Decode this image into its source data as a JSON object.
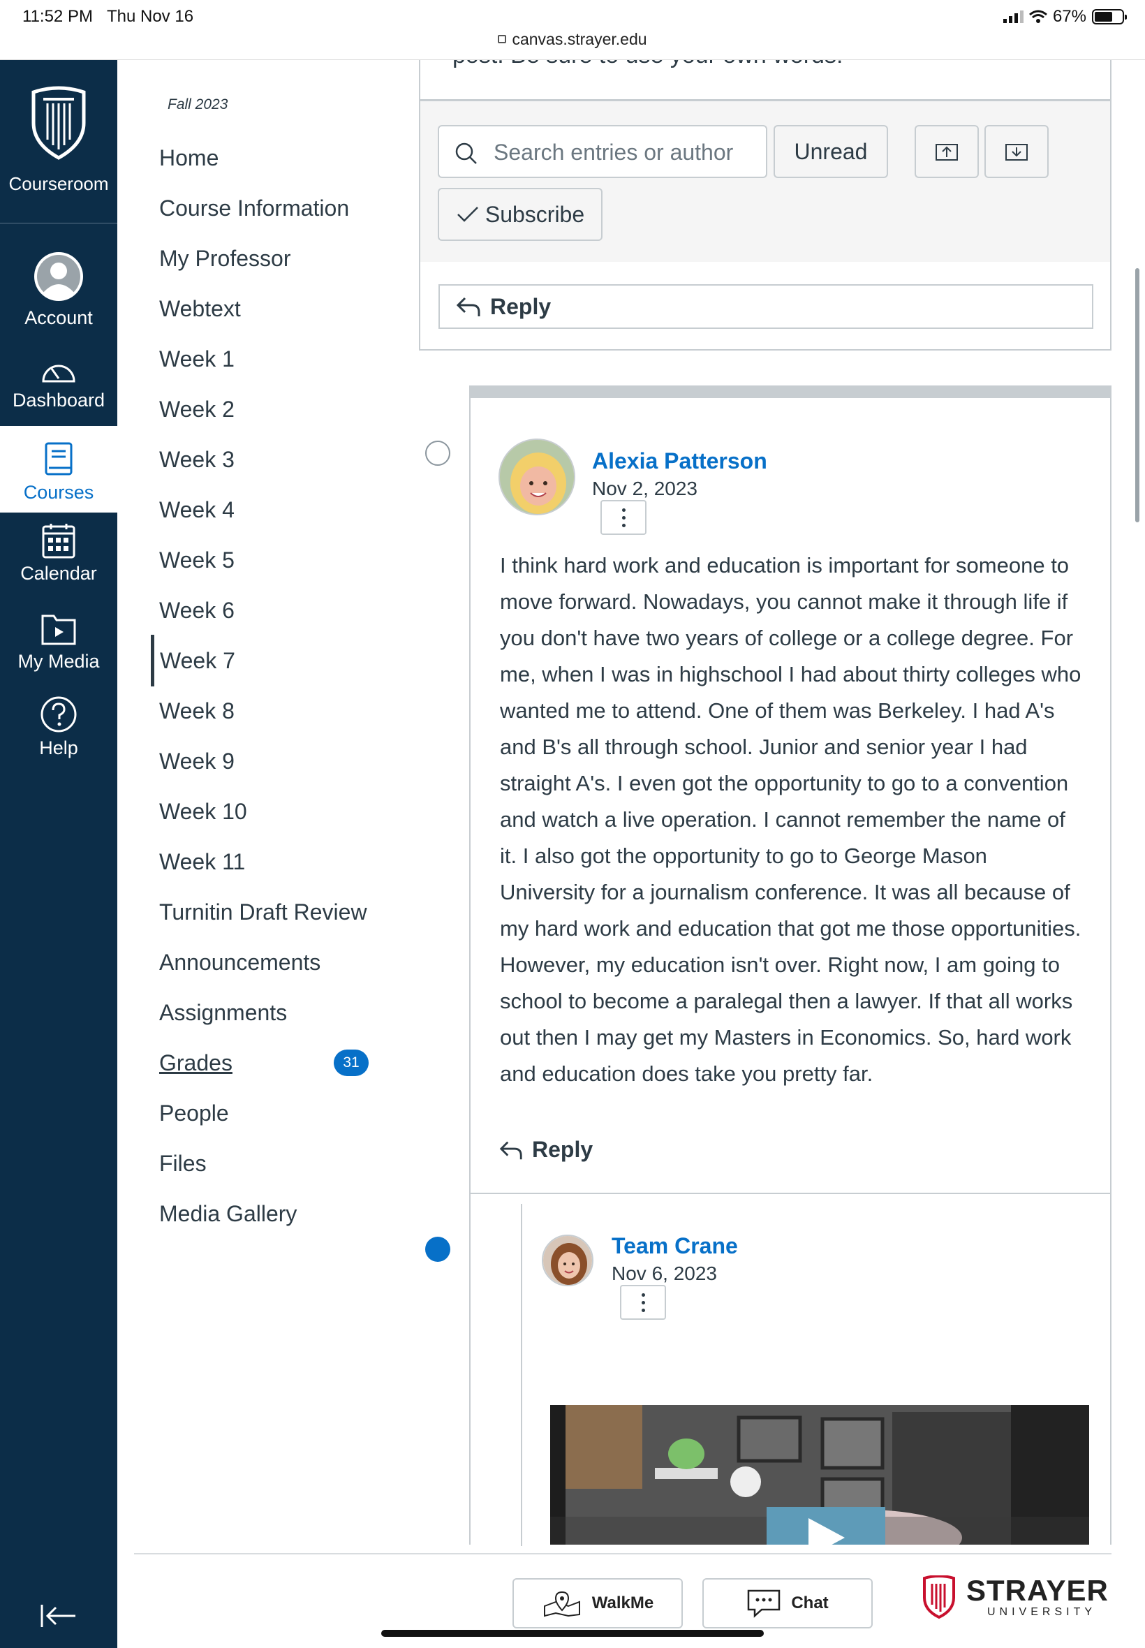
{
  "statusbar": {
    "time": "11:52 PM",
    "date": "Thu Nov 16",
    "url": "canvas.strayer.edu",
    "battery": "67%",
    "battery_level": 0.67
  },
  "globalnav": {
    "brand_label": "Courseroom",
    "items": [
      {
        "label": "Account",
        "icon": "account-avatar-icon"
      },
      {
        "label": "Dashboard",
        "icon": "dashboard-gauge-icon"
      },
      {
        "label": "Courses",
        "icon": "courses-book-icon"
      },
      {
        "label": "Calendar",
        "icon": "calendar-icon"
      },
      {
        "label": "My Media",
        "icon": "media-folder-icon"
      },
      {
        "label": "Help",
        "icon": "help-question-icon"
      }
    ]
  },
  "coursenav": {
    "term": "Fall 2023",
    "items": [
      "Home",
      "Course Information",
      "My Professor",
      "Webtext",
      "Week 1",
      "Week 2",
      "Week 3",
      "Week 4",
      "Week 5",
      "Week 6",
      "Week 7",
      "Week 8",
      "Week 9",
      "Week 10",
      "Week 11",
      "Turnitin Draft Review",
      "Announcements",
      "Assignments",
      "Grades",
      "People",
      "Files",
      "Media Gallery"
    ],
    "active": "Week 7",
    "grades_badge": "31"
  },
  "discussion": {
    "prompt_tail": "post. Be sure to use your own words!",
    "search_placeholder": "Search entries or author",
    "unread_label": "Unread",
    "subscribe_label": "Subscribe",
    "reply_label": "Reply"
  },
  "entries": [
    {
      "author": "Alexia Patterson",
      "date": "Nov 2, 2023",
      "body": "I think hard work and education is important for someone to move forward. Nowadays, you cannot make it through life if you don't have two years of college or a college degree. For me, when I was in highschool I had about thirty colleges who wanted me to attend. One of them was Berkeley. I had A's and B's all through school. Junior and senior year I had straight A's. I even got the opportunity to go to a convention and watch a live operation. I cannot remember the name of it. I also got the opportunity to go to George Mason University for a journalism conference. It was all because of my hard work and education that got me those opportunities. However, my education isn't over. Right now, I am going to school to become a paralegal then a lawyer. If that all works out then I may get my Masters in Economics. So, hard work and education does take you pretty far.",
      "reply_label": "Reply",
      "read": true
    },
    {
      "author": "Team Crane",
      "date": "Nov 6, 2023",
      "read": false
    }
  ],
  "bottombar": {
    "walkme_label": "WalkMe",
    "chat_label": "Chat",
    "brand_name": "STRAYER",
    "brand_sub": "UNIVERSITY"
  },
  "colors": {
    "nav_bg": "#0c2d48",
    "accent": "#0770c8",
    "text": "#2d3b45",
    "border": "#c7cdd1"
  }
}
